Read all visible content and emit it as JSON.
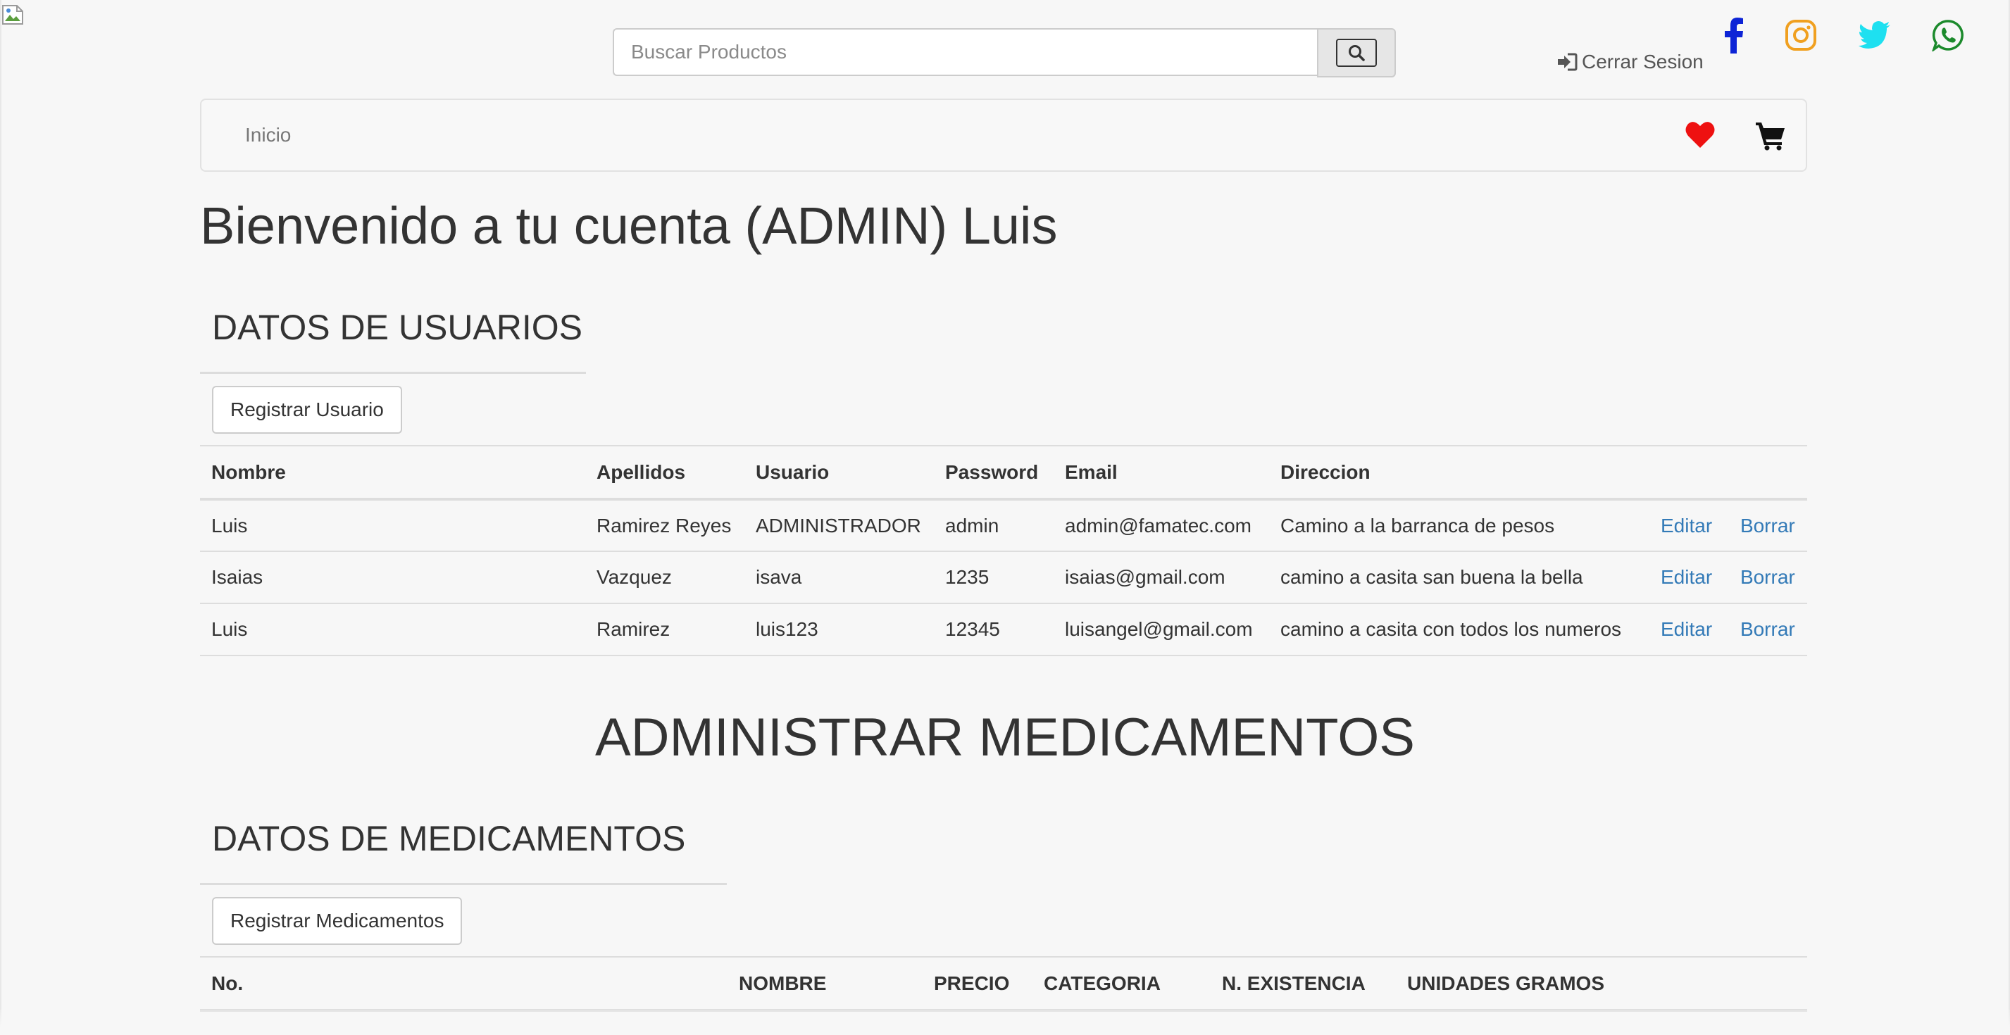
{
  "search": {
    "placeholder": "Buscar Productos"
  },
  "header": {
    "logout_label": "Cerrar Sesion"
  },
  "social": {
    "facebook_color": "#0d24d6",
    "instagram_color": "#f0a020",
    "twitter_color": "#1ee0f0",
    "whatsapp_color": "#1c8a2c"
  },
  "navbar": {
    "home_label": "Inicio",
    "heart_color": "#ee1111"
  },
  "welcome": "Bienvenido a tu cuenta (ADMIN) Luis",
  "users": {
    "title": "DATOS DE USUARIOS",
    "register_label": "Registrar Usuario",
    "headers": [
      "Nombre",
      "Apellidos",
      "Usuario",
      "Password",
      "Email",
      "Direccion",
      ""
    ],
    "rows": [
      {
        "nombre": "Luis",
        "apellidos": "Ramirez Reyes",
        "usuario": "ADMINISTRADOR",
        "password": "admin",
        "email": "admin@famatec.com",
        "direccion": "Camino a la barranca de pesos",
        "edit": "Editar",
        "delete": "Borrar"
      },
      {
        "nombre": "Isaias",
        "apellidos": "Vazquez",
        "usuario": "isava",
        "password": "1235",
        "email": "isaias@gmail.com",
        "direccion": "camino a casita san buena la bella",
        "edit": "Editar",
        "delete": "Borrar"
      },
      {
        "nombre": "Luis",
        "apellidos": "Ramirez",
        "usuario": "luis123",
        "password": "12345",
        "email": "luisangel@gmail.com",
        "direccion": "camino a casita con todos los numeros",
        "edit": "Editar",
        "delete": "Borrar"
      }
    ]
  },
  "admin_heading": "ADMINISTRAR MEDICAMENTOS",
  "meds": {
    "title": "DATOS DE MEDICAMENTOS",
    "register_label": "Registrar Medicamentos",
    "headers": [
      "No.",
      "NOMBRE",
      "PRECIO",
      "CATEGORIA",
      "N. EXISTENCIA",
      "UNIDADES GRAMOS",
      ""
    ]
  }
}
